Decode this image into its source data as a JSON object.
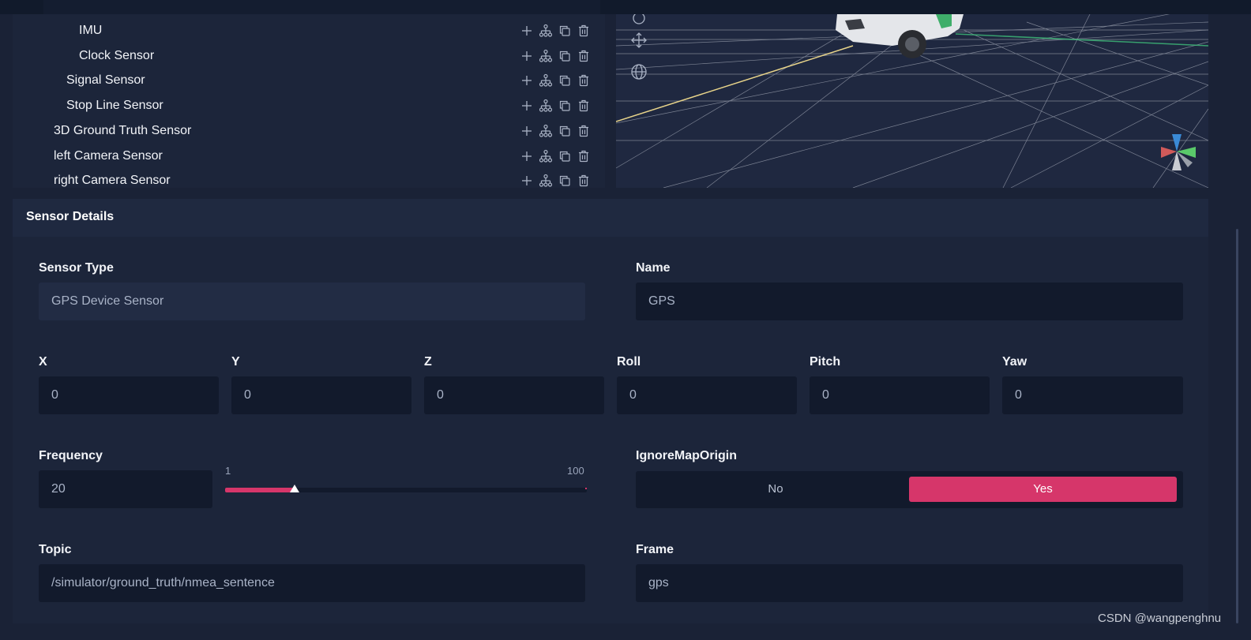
{
  "tree": {
    "items": [
      {
        "label": "IMU",
        "indent": 3
      },
      {
        "label": "Clock Sensor",
        "indent": 3
      },
      {
        "label": "Signal Sensor",
        "indent": 2
      },
      {
        "label": "Stop Line Sensor",
        "indent": 2
      },
      {
        "label": "3D Ground Truth Sensor",
        "indent": 1
      },
      {
        "label": "left Camera Sensor",
        "indent": 1
      },
      {
        "label": "right Camera Sensor",
        "indent": 1
      }
    ],
    "action_icons": [
      "plus-icon",
      "hierarchy-icon",
      "copy-icon",
      "trash-icon"
    ]
  },
  "viewport": {
    "tools": [
      "rotate-icon",
      "move-icon",
      "globe-icon"
    ],
    "gizmo": "axis-gizmo-icon"
  },
  "details": {
    "title": "Sensor Details",
    "sensor_type": {
      "label": "Sensor Type",
      "value": "GPS Device Sensor"
    },
    "name": {
      "label": "Name",
      "value": "GPS"
    },
    "x": {
      "label": "X",
      "value": "0"
    },
    "y": {
      "label": "Y",
      "value": "0"
    },
    "z": {
      "label": "Z",
      "value": "0"
    },
    "roll": {
      "label": "Roll",
      "value": "0"
    },
    "pitch": {
      "label": "Pitch",
      "value": "0"
    },
    "yaw": {
      "label": "Yaw",
      "value": "0"
    },
    "frequency": {
      "label": "Frequency",
      "value": "20",
      "min": "1",
      "max": "100",
      "slider_value": 20
    },
    "ignore_map_origin": {
      "label": "IgnoreMapOrigin",
      "no": "No",
      "yes": "Yes",
      "selected": "Yes"
    },
    "topic": {
      "label": "Topic",
      "value": "/simulator/ground_truth/nmea_sentence"
    },
    "frame": {
      "label": "Frame",
      "value": "gps"
    }
  },
  "colors": {
    "accent": "#d6366a",
    "panel": "#1c253a",
    "field": "#121a2c"
  },
  "watermark": "CSDN @wangpenghnu"
}
